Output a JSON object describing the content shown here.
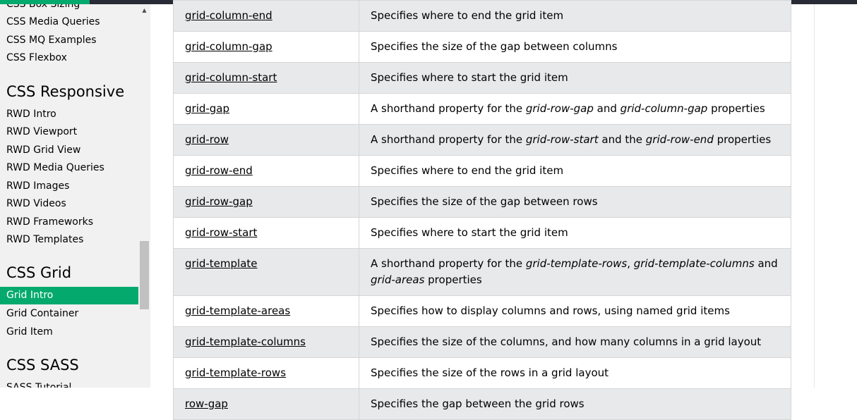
{
  "colors": {
    "accent": "#04AA6D",
    "topbar": "#282a35",
    "sidebar_bg": "#f1f1f1",
    "row_alt": "#e7e9eb"
  },
  "sidebar": {
    "partial_top_item": "CSS Box Sizing",
    "items_top": [
      "CSS Media Queries",
      "CSS MQ Examples",
      "CSS Flexbox"
    ],
    "section_responsive": "CSS Responsive",
    "items_responsive": [
      "RWD Intro",
      "RWD Viewport",
      "RWD Grid View",
      "RWD Media Queries",
      "RWD Images",
      "RWD Videos",
      "RWD Frameworks",
      "RWD Templates"
    ],
    "section_grid": "CSS Grid",
    "items_grid": [
      "Grid Intro",
      "Grid Container",
      "Grid Item"
    ],
    "active_item": "Grid Intro",
    "section_sass": "CSS SASS",
    "partial_bottom_item": "SASS Tutorial"
  },
  "table": {
    "rows": [
      {
        "prop": "grid-column-end",
        "desc": [
          "Specifies where to end the grid item"
        ]
      },
      {
        "prop": "grid-column-gap",
        "desc": [
          "Specifies the size of the gap between columns"
        ]
      },
      {
        "prop": "grid-column-start",
        "desc": [
          "Specifies where to start the grid item"
        ]
      },
      {
        "prop": "grid-gap",
        "desc": [
          "A shorthand property for the ",
          "grid-row-gap",
          " and ",
          "grid-column-gap",
          " properties"
        ]
      },
      {
        "prop": "grid-row",
        "desc": [
          "A shorthand property for the ",
          "grid-row-start",
          " and the ",
          "grid-row-end",
          " properties"
        ]
      },
      {
        "prop": "grid-row-end",
        "desc": [
          "Specifies where to end the grid item"
        ]
      },
      {
        "prop": "grid-row-gap",
        "desc": [
          "Specifies the size of the gap between rows"
        ]
      },
      {
        "prop": "grid-row-start",
        "desc": [
          "Specifies where to start the grid item"
        ]
      },
      {
        "prop": "grid-template",
        "desc": [
          "A shorthand property for the ",
          "grid-template-rows",
          ", ",
          "grid-template-columns",
          " and ",
          "grid-areas",
          " properties"
        ]
      },
      {
        "prop": "grid-template-areas",
        "desc": [
          "Specifies how to display columns and rows, using named grid items"
        ]
      },
      {
        "prop": "grid-template-columns",
        "desc": [
          "Specifies the size of the columns, and how many columns in a grid layout"
        ]
      },
      {
        "prop": "grid-template-rows",
        "desc": [
          "Specifies the size of the rows in a grid layout"
        ]
      },
      {
        "prop": "row-gap",
        "desc": [
          "Specifies the gap between the grid rows"
        ]
      }
    ]
  }
}
